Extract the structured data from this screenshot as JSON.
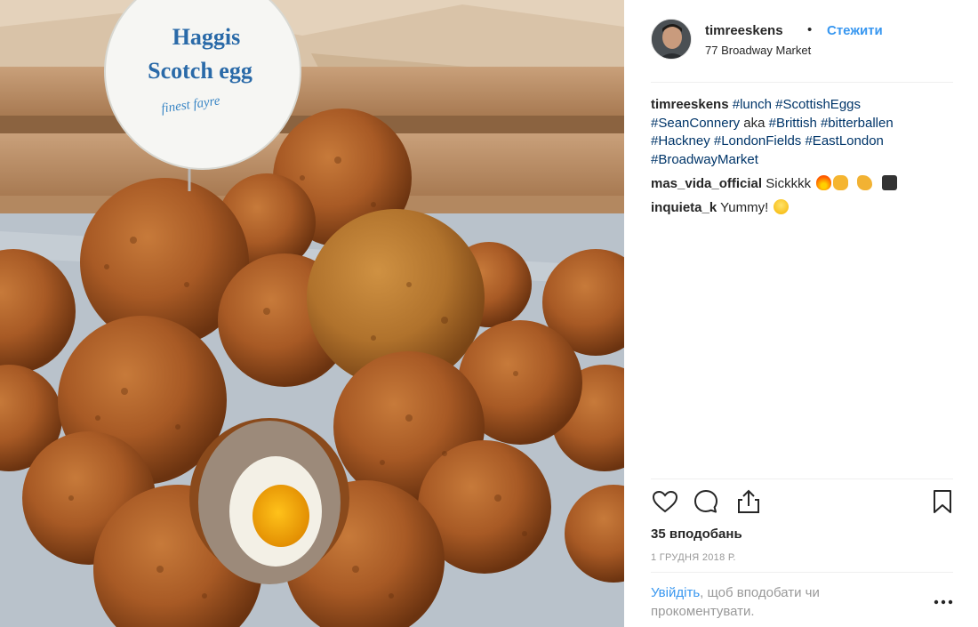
{
  "post": {
    "username": "timreeskens",
    "separator": "•",
    "follow_label": "Стежити",
    "location": "77 Broadway Market"
  },
  "photo": {
    "sign_line1": "Haggis",
    "sign_line2": "Scotch egg",
    "sign_tagline": "finest fayre"
  },
  "caption": {
    "username": "timreeskens",
    "parts": [
      "#lunch",
      "#ScottishEggs",
      "#SeanConnery",
      "aka",
      "#Brittish",
      "#bitterballen",
      "#Hackney",
      "#LondonFields",
      "#EastLondon",
      "#BroadwayMarket"
    ]
  },
  "comments": [
    {
      "username": "mas_vida_official",
      "text": "Sickkkk",
      "emojis": [
        "fire-emoji",
        "ok-hand-emoji",
        "flexed-biceps-emoji",
        "robot-emoji"
      ]
    },
    {
      "username": "inquieta_k",
      "text": "Yummy!",
      "emojis": [
        "grinning-sweat-emoji"
      ]
    }
  ],
  "actions": {
    "like": "heart-icon",
    "comment": "comment-icon",
    "share": "share-icon",
    "save": "bookmark-icon"
  },
  "likes_text": "35 вподобань",
  "date_text": "1 ГРУДНЯ 2018 Р.",
  "login": {
    "link_text": "Увійдіть",
    "rest_text": ", щоб вподобати чи прокоментувати."
  },
  "more_icon": "more-options-icon",
  "colors": {
    "link": "#3897f0",
    "hashtag": "#003569",
    "text": "#262626",
    "muted": "#999999"
  }
}
